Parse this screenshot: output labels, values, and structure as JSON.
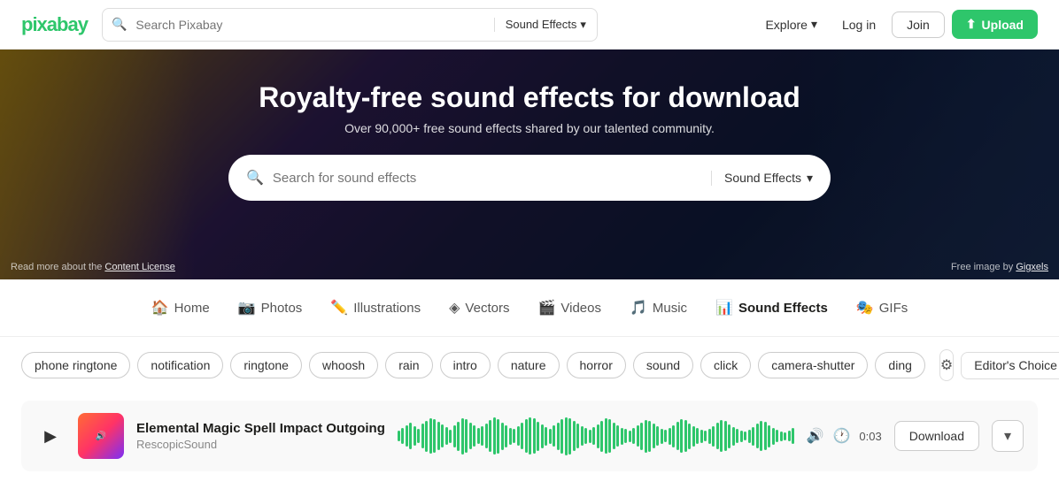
{
  "header": {
    "logo_text": "pixabay",
    "search_placeholder": "Search Pixabay",
    "search_type": "Sound Effects",
    "explore_label": "Explore",
    "login_label": "Log in",
    "join_label": "Join",
    "upload_label": "Upload"
  },
  "hero": {
    "title": "Royalty-free sound effects for download",
    "subtitle": "Over 90,000+ free sound effects shared by our talented community.",
    "search_placeholder": "Search for sound effects",
    "search_type": "Sound Effects",
    "license_text": "Read more about the ",
    "license_link": "Content License",
    "credit_text": "Free image by ",
    "credit_link": "Gigxels"
  },
  "nav": {
    "tabs": [
      {
        "id": "home",
        "icon": "🏠",
        "label": "Home"
      },
      {
        "id": "photos",
        "icon": "📷",
        "label": "Photos"
      },
      {
        "id": "illustrations",
        "icon": "✏️",
        "label": "Illustrations"
      },
      {
        "id": "vectors",
        "icon": "◈",
        "label": "Vectors"
      },
      {
        "id": "videos",
        "icon": "🎬",
        "label": "Videos"
      },
      {
        "id": "music",
        "icon": "🎵",
        "label": "Music"
      },
      {
        "id": "sound-effects",
        "icon": "📊",
        "label": "Sound Effects",
        "active": true
      },
      {
        "id": "gifs",
        "icon": "🎭",
        "label": "GIFs"
      }
    ]
  },
  "filters": {
    "tags": [
      "phone ringtone",
      "notification",
      "ringtone",
      "whoosh",
      "rain",
      "intro",
      "nature",
      "horror",
      "sound",
      "click",
      "camera-shutter",
      "ding"
    ],
    "settings_icon": "⚙",
    "sort_label": "Editor's Choice",
    "sort_chevron": "▾"
  },
  "sounds": [
    {
      "id": 1,
      "title": "Elemental Magic Spell Impact Outgoing",
      "author": "RescopicSound",
      "duration": "0:03",
      "waveform_bars": [
        12,
        18,
        24,
        30,
        22,
        16,
        28,
        35,
        40,
        38,
        32,
        26,
        20,
        15,
        25,
        33,
        41,
        38,
        30,
        24,
        18,
        22,
        28,
        36,
        42,
        39,
        31,
        25,
        19,
        16,
        22,
        30,
        38,
        42,
        40,
        33,
        27,
        21,
        17,
        24,
        31,
        39,
        43,
        41,
        34,
        28,
        22,
        18,
        15,
        20,
        27,
        35,
        40,
        38,
        30,
        24,
        19,
        16,
        13,
        18,
        24,
        31,
        37,
        35,
        28,
        22,
        17,
        14,
        19,
        25,
        32,
        38,
        36,
        29,
        23,
        18,
        15,
        12,
        17,
        23,
        30,
        36,
        34,
        27,
        21,
        16,
        13,
        10,
        15,
        21,
        28,
        34,
        32,
        25,
        19,
        14,
        11,
        9,
        12,
        18,
        25,
        31,
        29,
        22,
        16,
        12,
        9,
        7,
        10,
        16,
        22,
        28,
        26,
        20,
        14,
        10,
        8,
        6,
        9,
        14,
        20,
        26,
        24,
        18,
        12,
        9,
        6
      ]
    }
  ]
}
